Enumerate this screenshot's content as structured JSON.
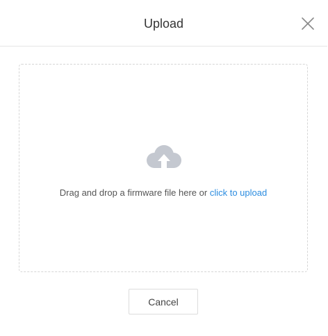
{
  "dialog": {
    "title": "Upload",
    "close_icon": "close-icon"
  },
  "dropzone": {
    "icon": "cloud-upload-icon",
    "hint_text": "Drag and drop a firmware file here or ",
    "link_text": "click to upload"
  },
  "footer": {
    "cancel_label": "Cancel"
  },
  "colors": {
    "link": "#2b8ce0",
    "icon": "#c4c8d0",
    "border": "#d5d5d5"
  }
}
